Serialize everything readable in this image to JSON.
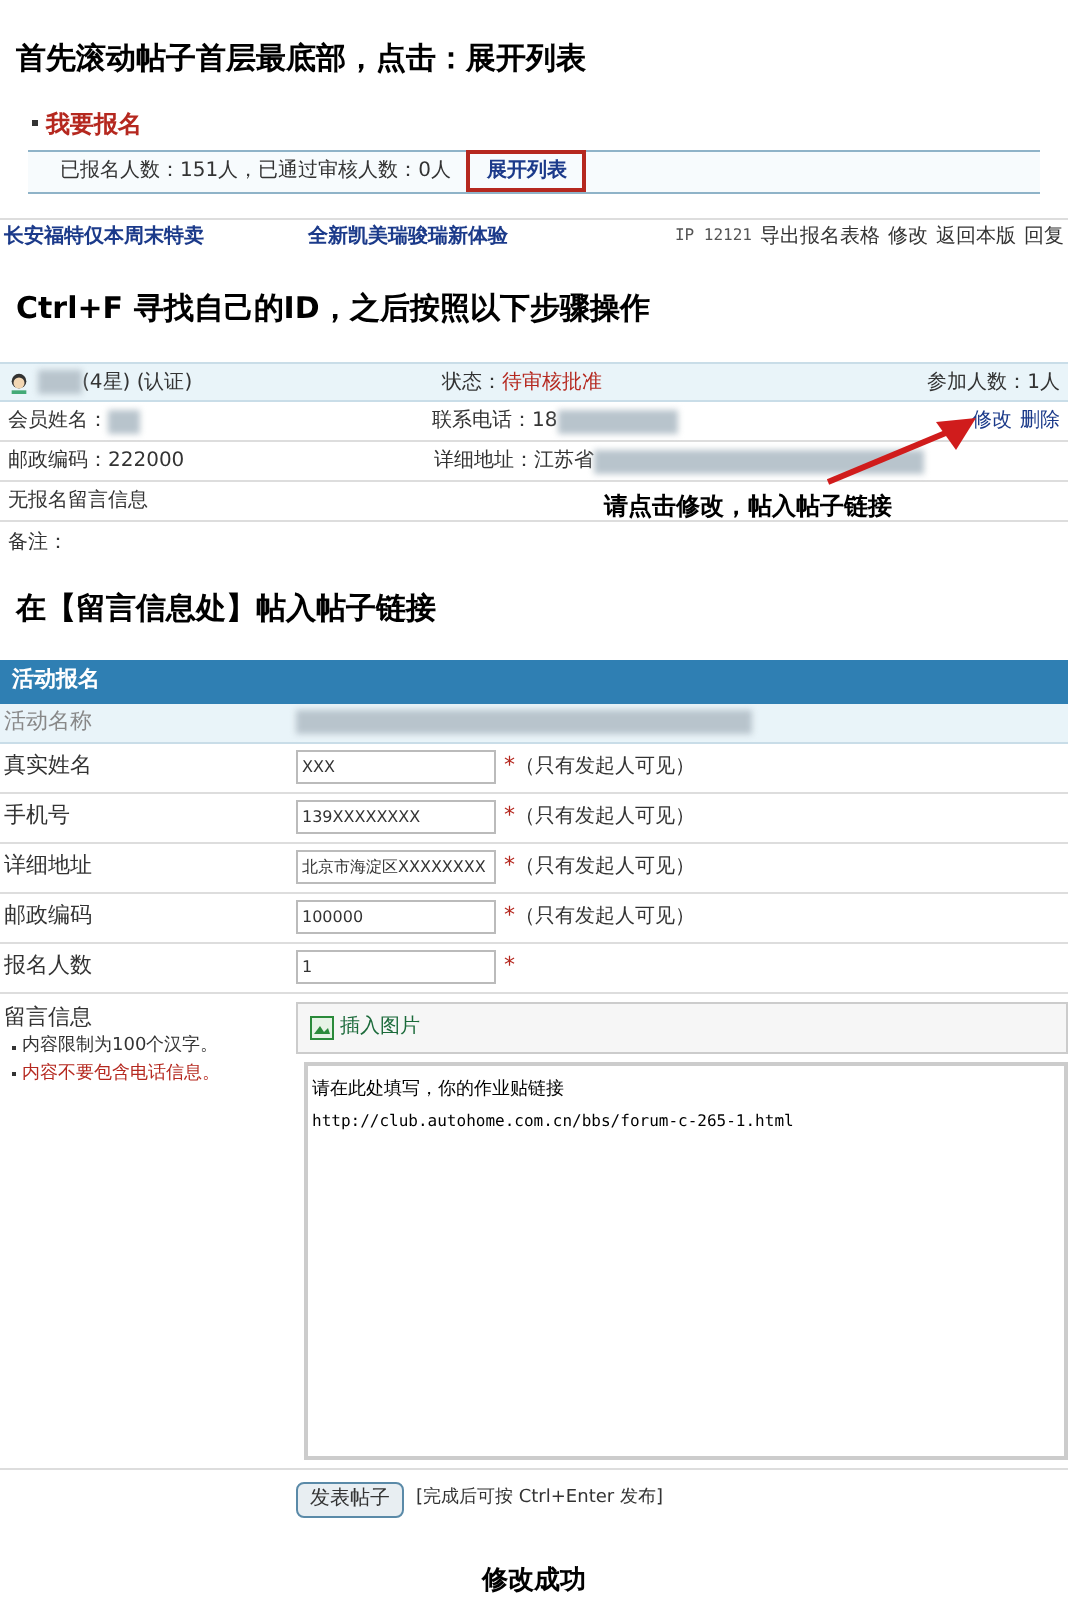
{
  "step1": {
    "heading": "首先滚动帖子首层最底部，点击：展开列表",
    "signup_title": "我要报名",
    "summary": "已报名人数：151人，已通过审核人数：0人",
    "expand_link": "展开列表"
  },
  "thread_bar": {
    "links": [
      "长安福特仅本周末特卖",
      "全新凯美瑞骏瑞新体验"
    ],
    "ip": "IP 12121",
    "actions": [
      "导出报名表格",
      "修改",
      "返回本版",
      "回复"
    ]
  },
  "step2": {
    "heading": "Ctrl+F 寻找自己的ID，之后按照以下步骤操作"
  },
  "entry": {
    "user_suffix": "(4星) (认证)",
    "status_label": "状态：",
    "status": "待审核批准",
    "count": "参加人数：1人",
    "member_label": "会员姓名：",
    "phone_label": "联系电话：18",
    "edit": "修改",
    "delete": "删除",
    "zip": "邮政编码：222000",
    "address_label": "详细地址：江苏省",
    "no_message": "无报名留言信息",
    "note": "备注：",
    "callout": "请点击修改，帖入帖子链接"
  },
  "step3": {
    "heading": "在【留言信息处】帖入帖子链接"
  },
  "form": {
    "title": "活动报名",
    "name_label": "活动名称",
    "fields": [
      {
        "label": "真实姓名",
        "value": "XXX",
        "hint": "（只有发起人可见）"
      },
      {
        "label": "手机号",
        "value": "139XXXXXXXX",
        "hint": "（只有发起人可见）"
      },
      {
        "label": "详细地址",
        "value": "北京市海淀区XXXXXXXX",
        "hint": "（只有发起人可见）"
      },
      {
        "label": "邮政编码",
        "value": "100000",
        "hint": "（只有发起人可见）"
      },
      {
        "label": "报名人数",
        "value": "1"
      }
    ],
    "required_mark": "*",
    "message_label": "留言信息",
    "rules": [
      {
        "text": "内容限制为100个汉字。",
        "warning": false
      },
      {
        "text": "内容不要包含电话信息。",
        "warning": true
      }
    ],
    "insert_image": "插入图片",
    "message_lines": [
      "请在此处填写，你的作业贴链接",
      "http://club.autohome.com.cn/bbs/forum-c-265-1.html"
    ],
    "submit": "发表帖子",
    "submit_hint": "[完成后可按 Ctrl+Enter 发布]"
  },
  "result": "修改成功"
}
